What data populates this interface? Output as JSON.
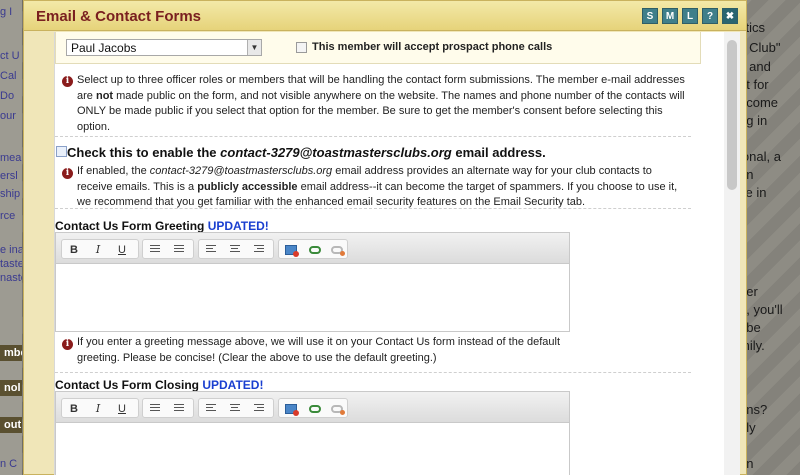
{
  "background": {
    "left_fragments": [
      "g I",
      "ct U",
      "Cal",
      "Do",
      "our",
      "mea",
      "ersl",
      "ship",
      "rce",
      "e ina",
      "taste",
      "naste",
      "mbe",
      "nol",
      "out",
      "n C"
    ],
    "right_fragments": [
      "stics",
      "s Club\"",
      "y and",
      "nt for",
      "ecome",
      "ng in",
      "ional, a",
      "on",
      "ce in",
      "tter",
      "b, you'll",
      ", be",
      "mily.",
      "ons?",
      "ely",
      "en"
    ]
  },
  "dialog": {
    "title": "Email & Contact Forms",
    "buttons": [
      "S",
      "M",
      "L",
      "?"
    ],
    "close_symbol": "✖"
  },
  "member_row": {
    "selected_member": "Paul Jacobs",
    "phone_label": "This member will accept prospact phone calls"
  },
  "officer_note": {
    "text_1": "Select up to three officer roles or members that will be handling the contact form submissions. The member e-mail addresses are ",
    "bold_1": "not",
    "text_2": " made public on the form, and not visible anywhere on the website. The names and phone number of the contacts will ONLY be made public if you select that option for the member. Be sure to get the member's consent before selecting this option."
  },
  "email_option": {
    "label_prefix": "Check this to enable the ",
    "address": "contact-3279@toastmastersclubs.org",
    "label_suffix": " email address.",
    "note_1": "If enabled, the ",
    "note_address": "contact-3279@toastmastersclubs.org",
    "note_2": " email address provides an alternate way for your club contacts to receive emails. This is a ",
    "note_bold": "publicly accessible",
    "note_3": " email address--it can become the target of spammers. If you choose to use it, we recommend that you get familiar with the enhanced email security features on the Email Security tab."
  },
  "greeting": {
    "title": "Contact Us Form Greeting ",
    "badge": "UPDATED!",
    "note": "If you enter a greeting message above, we will use it on your Contact Us form instead of the default greeting. Please be concise! (Clear the above to use the default greeting.)"
  },
  "closing": {
    "title": "Contact Us Form Closing ",
    "badge": "UPDATED!"
  },
  "toolbar": {
    "bold": "B",
    "italic": "I",
    "underline": "U"
  },
  "colors": {
    "title_text": "#7a2020",
    "updated_badge": "#1a3fd0",
    "info_icon": "#8a1c1c",
    "title_buttons": "#3f7f8a"
  }
}
